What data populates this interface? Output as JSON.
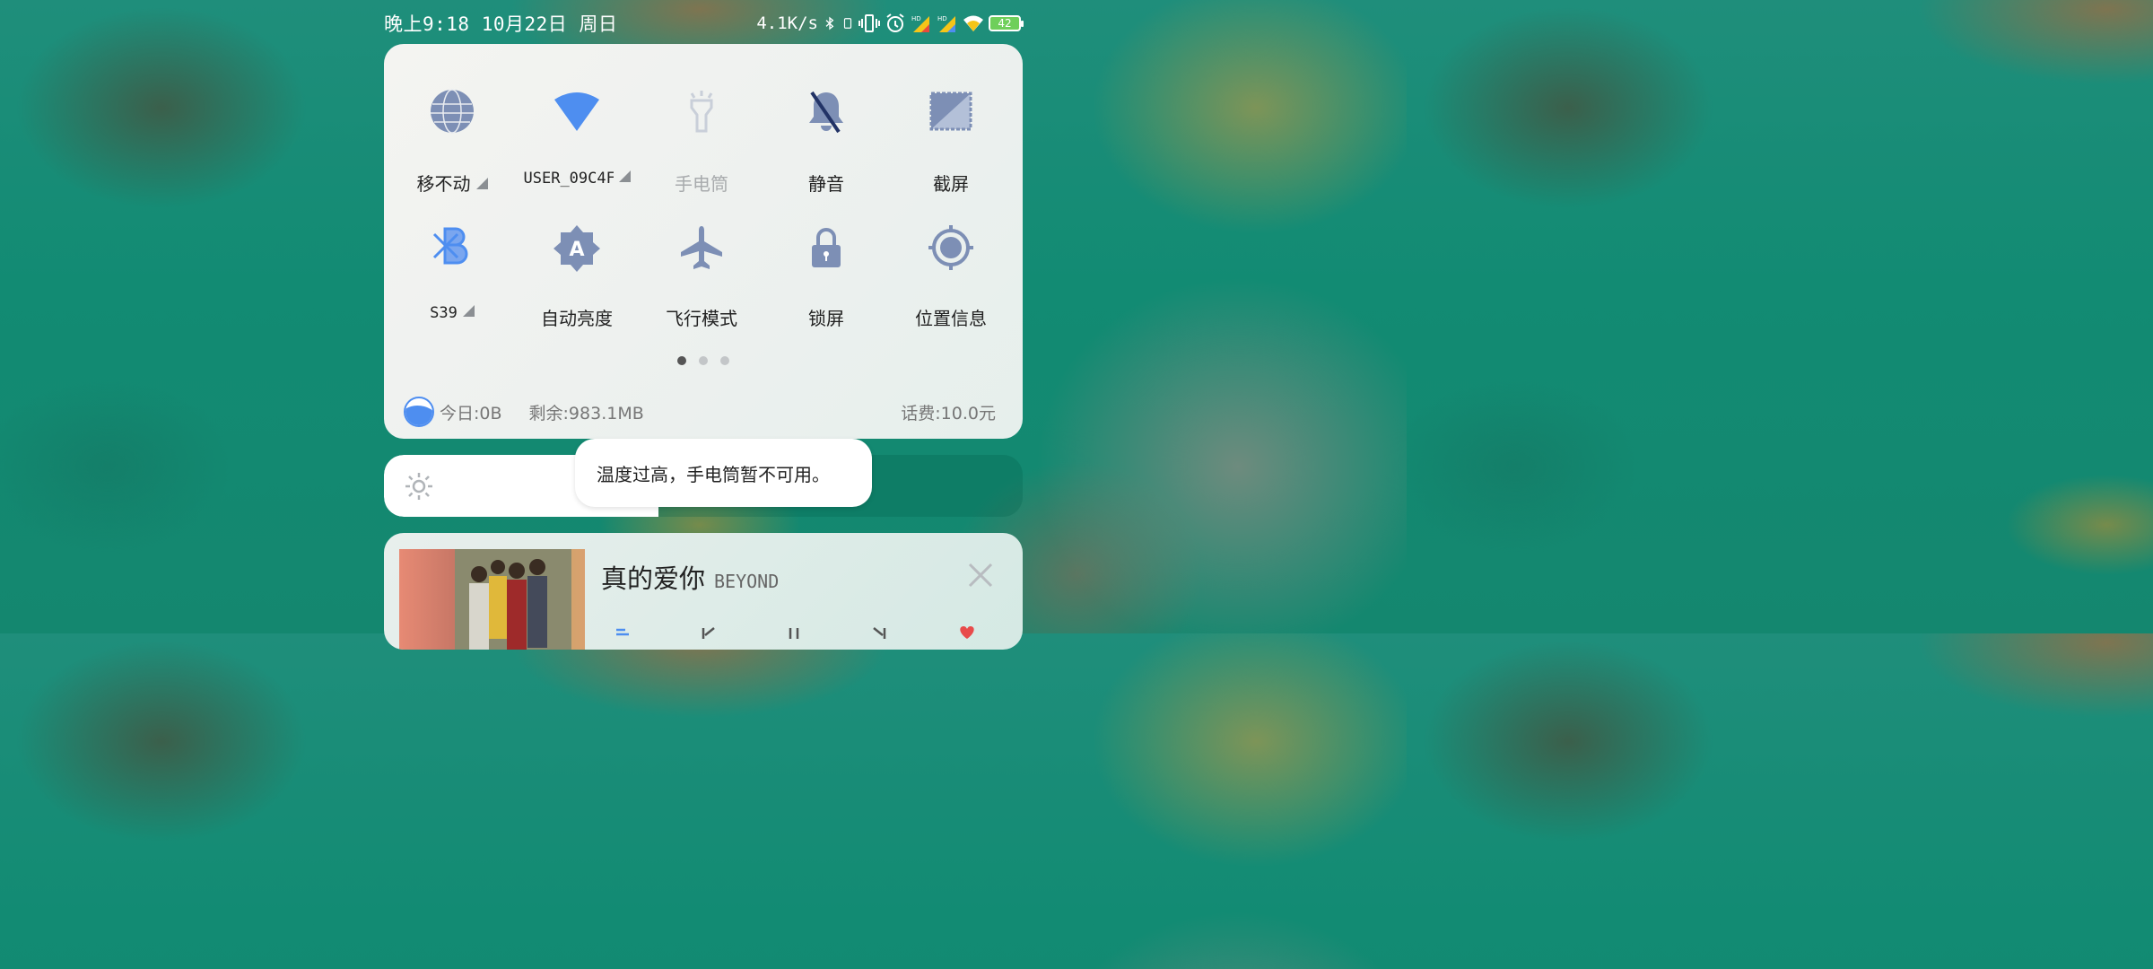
{
  "status_bar": {
    "datetime": "晚上9:18 10月22日 周日",
    "net_speed": "4.1K/s",
    "battery": "42",
    "icons": [
      "bluetooth-icon",
      "battery-saver-icon",
      "vibrate-icon",
      "alarm-icon",
      "hd-signal-icon",
      "hd-signal-icon",
      "wifi-icon",
      "battery-icon"
    ]
  },
  "quick_settings": {
    "tiles": [
      {
        "label": "移不动",
        "icon": "globe-icon",
        "has_menu": true
      },
      {
        "label": "USER_09C4F",
        "icon": "wifi-icon",
        "has_menu": true
      },
      {
        "label": "手电筒",
        "icon": "flashlight-icon",
        "disabled": true
      },
      {
        "label": "静音",
        "icon": "bell-off-icon"
      },
      {
        "label": "截屏",
        "icon": "screenshot-icon"
      },
      {
        "label": "S39",
        "icon": "bluetooth-icon",
        "has_menu": true
      },
      {
        "label": "自动亮度",
        "icon": "auto-brightness-icon"
      },
      {
        "label": "飞行模式",
        "icon": "airplane-icon"
      },
      {
        "label": "锁屏",
        "icon": "lock-icon"
      },
      {
        "label": "位置信息",
        "icon": "location-icon"
      }
    ],
    "page_count": 3,
    "active_page": 1
  },
  "data_usage": {
    "today": "今日:0B",
    "remaining": "剩余:983.1MB",
    "balance": "话费:10.0元"
  },
  "brightness": {
    "level": 0.43
  },
  "toast": {
    "text": "温度过高，手电筒暂不可用。"
  },
  "media": {
    "title": "真的爱你",
    "artist": "BEYOND"
  },
  "colors": {
    "accent": "#4e8ef0",
    "tile_icon": "#7d8fb5"
  }
}
